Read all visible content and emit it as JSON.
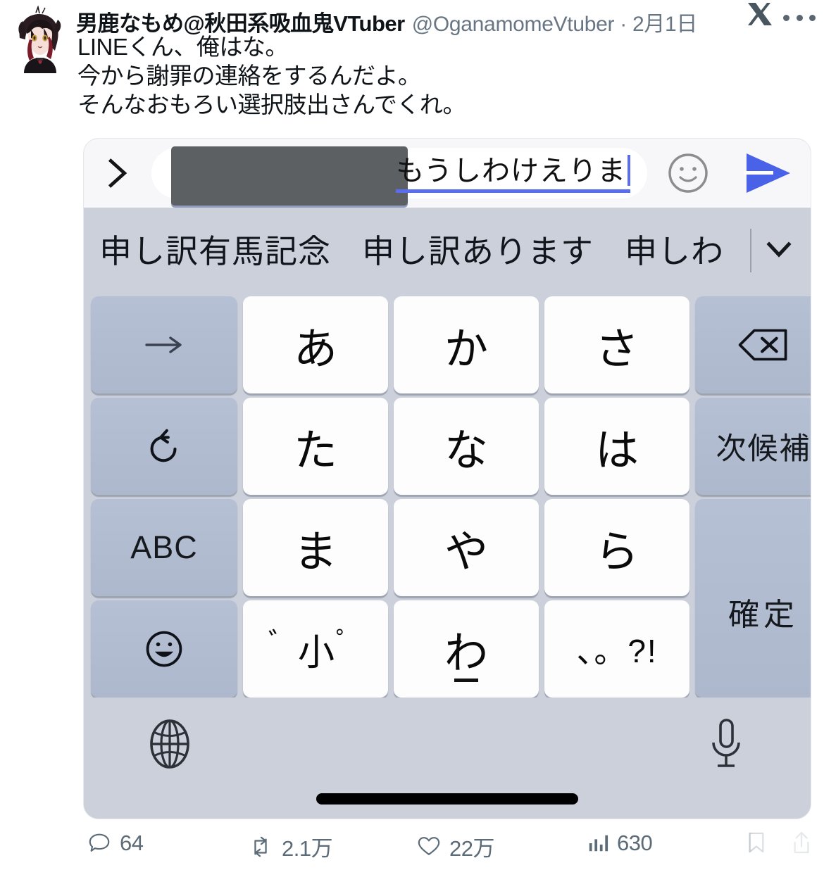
{
  "post": {
    "display_name": "男鹿なもめ@秋田系吸血鬼VTuber",
    "handle_and_date": "@OganamomeVtuber · 2月1日",
    "body_lines": [
      "LINEくん、俺はな。",
      "今から謝罪の連絡をするんだよ。",
      "そんなおもろい選択肢出さんでくれ。"
    ],
    "x_logo_icon": "x-logo-icon",
    "more_icon": "more-options-icon",
    "avatar_icon": "avatar"
  },
  "media": {
    "chat_bar": {
      "back_icon": "chevron-right-icon",
      "redacted_label": "",
      "composing_text": "もうしわけえりま",
      "emoji_icon": "smiley-face-icon",
      "send_icon": "send-arrow-icon"
    },
    "suggestions": {
      "items": [
        "申し訳有馬記念",
        "申し訳あります",
        "申しわ"
      ],
      "expand_icon": "chevron-down-icon"
    },
    "keypad": {
      "rows": [
        [
          {
            "label": "→",
            "type": "fn",
            "name": "cursor-right-key"
          },
          {
            "label": "あ",
            "type": "char",
            "name": "kana-a-key"
          },
          {
            "label": "か",
            "type": "char",
            "name": "kana-ka-key"
          },
          {
            "label": "さ",
            "type": "char",
            "name": "kana-sa-key"
          },
          {
            "label": "",
            "type": "fn",
            "name": "backspace-key",
            "icon": "backspace-icon"
          }
        ],
        [
          {
            "label": "",
            "type": "fn",
            "name": "undo-key",
            "icon": "undo-icon"
          },
          {
            "label": "た",
            "type": "char",
            "name": "kana-ta-key"
          },
          {
            "label": "な",
            "type": "char",
            "name": "kana-na-key"
          },
          {
            "label": "は",
            "type": "char",
            "name": "kana-ha-key"
          },
          {
            "label": "次候補",
            "type": "fn",
            "name": "next-candidate-key"
          }
        ],
        [
          {
            "label": "ABC",
            "type": "fn",
            "name": "abc-mode-key"
          },
          {
            "label": "ま",
            "type": "char",
            "name": "kana-ma-key"
          },
          {
            "label": "や",
            "type": "char",
            "name": "kana-ya-key"
          },
          {
            "label": "ら",
            "type": "char",
            "name": "kana-ra-key"
          },
          {
            "label": "確定",
            "type": "fn",
            "name": "confirm-key"
          }
        ],
        [
          {
            "label": "",
            "type": "fn",
            "name": "emoji-key",
            "icon": "smiley-key-icon"
          },
          {
            "label": "小",
            "type": "char",
            "name": "small-kana-key",
            "dakuten": "゛",
            "handakuten": "゜"
          },
          {
            "label": "わ",
            "type": "char",
            "name": "kana-wa-key"
          },
          {
            "label": "、。?!",
            "type": "char",
            "name": "punctuation-key"
          }
        ]
      ]
    },
    "bottom_bar": {
      "globe_icon": "globe-icon",
      "mic_icon": "microphone-icon",
      "home_indicator": "home-indicator"
    }
  },
  "engagement": {
    "reply": {
      "icon": "reply-icon",
      "count": "64"
    },
    "repost": {
      "icon": "repost-icon",
      "count": "2.1万"
    },
    "like": {
      "icon": "heart-icon",
      "count": "22万"
    },
    "views": {
      "icon": "analytics-icon",
      "count": "630"
    },
    "bookmark": {
      "icon": "bookmark-icon"
    },
    "share": {
      "icon": "share-icon"
    }
  },
  "colors": {
    "text_primary": "#0f1419",
    "text_muted": "#687684",
    "accent_blue": "#5a6cf0",
    "keyboard_bg": "#ccd0da",
    "function_key": "#b2bccf"
  }
}
